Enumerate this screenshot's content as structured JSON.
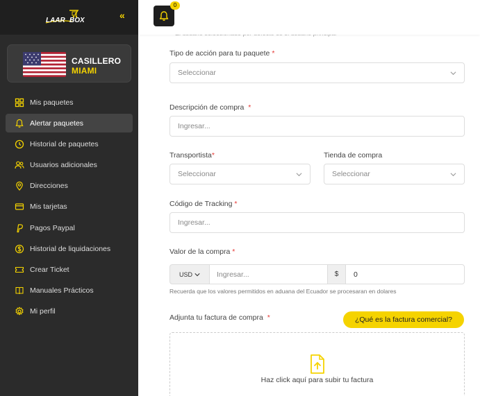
{
  "brand": {
    "logo_text": "LAAR BOX"
  },
  "locker": {
    "line1": "CASILLERO",
    "line2": "MIAMI"
  },
  "nav": [
    {
      "label": "Mis paquetes",
      "icon": "grid-icon"
    },
    {
      "label": "Alertar paquetes",
      "icon": "bell-icon"
    },
    {
      "label": "Historial de paquetes",
      "icon": "clock-icon"
    },
    {
      "label": "Usuarios adicionales",
      "icon": "users-icon"
    },
    {
      "label": "Direcciones",
      "icon": "map-pin-icon"
    },
    {
      "label": "Mis tarjetas",
      "icon": "credit-card-icon"
    },
    {
      "label": "Pagos Paypal",
      "icon": "paypal-icon"
    },
    {
      "label": "Historial de liquidaciones",
      "icon": "dollar-circle-icon"
    },
    {
      "label": "Crear Ticket",
      "icon": "ticket-icon"
    },
    {
      "label": "Manuales Prácticos",
      "icon": "book-icon"
    },
    {
      "label": "Mi perfil",
      "icon": "gear-icon"
    }
  ],
  "active_nav": "Alertar paquetes",
  "topbar": {
    "notification_count": "0"
  },
  "form": {
    "cut_text": "El usuario seleccionado por defecto es el usuario principal",
    "accion_label": "Tipo de acción para tu paquete",
    "accion_placeholder": "Seleccionar",
    "descripcion_label": "Descripción de compra",
    "descripcion_placeholder": "Ingresar...",
    "transportista_label": "Transportista",
    "transportista_placeholder": "Seleccionar",
    "tienda_label": "Tienda de compra",
    "tienda_placeholder": "Seleccionar",
    "tracking_label": "Código de Tracking",
    "tracking_placeholder": "Ingresar...",
    "valor_label": "Valor de la compra",
    "currency": "USD",
    "valor_placeholder": "Ingresar...",
    "dollar_sign": "$",
    "amount": "0",
    "note": "Recuerda que los valores permitidos en aduana del Ecuador se procesaran en dolares",
    "factura_label": "Adjunta tu factura de compra",
    "factura_help": "¿Qué es la factura comercial?",
    "upload_text": "Haz click aquí para subir tu factura",
    "required_mark": "*"
  },
  "colors": {
    "accent": "#f5d300",
    "sidebar": "#2b2b2b",
    "required": "#e53935"
  }
}
